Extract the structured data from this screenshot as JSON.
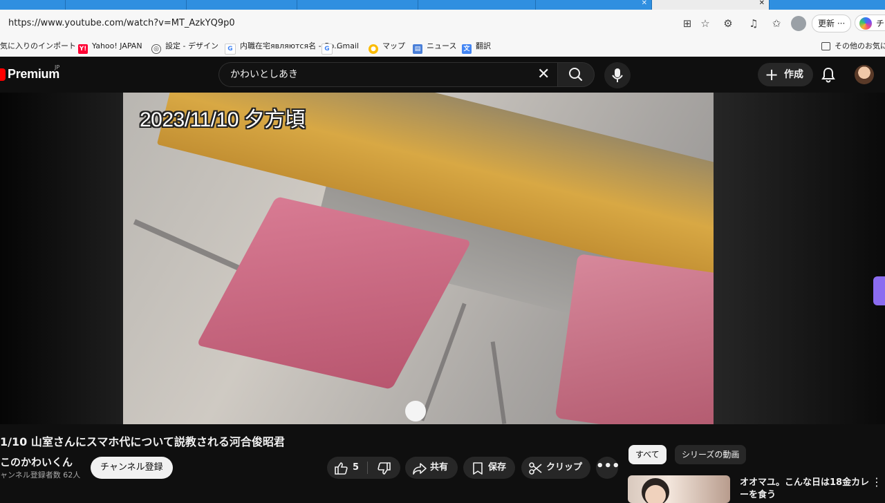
{
  "browser": {
    "tabs": [
      {
        "label": ""
      },
      {
        "label": ""
      },
      {
        "label": ""
      },
      {
        "label": ""
      },
      {
        "label": ""
      },
      {
        "label": ""
      },
      {
        "label": ""
      }
    ],
    "url": "https://www.youtube.com/watch?v=MT_AzkYQ9p0",
    "update_label": "更新",
    "copilot_label": "チャ",
    "bookmarks": [
      {
        "label": "気に入りのインポート"
      },
      {
        "label": "Yahoo! JAPAN"
      },
      {
        "label": "設定 - デザイン"
      },
      {
        "label": "内職在宅являются名 - Go..."
      },
      {
        "label": "Gmail"
      },
      {
        "label": "マップ"
      },
      {
        "label": "ニュース"
      },
      {
        "label": "翻訳"
      }
    ],
    "other_bookmarks": "その他のお気に入"
  },
  "masthead": {
    "logo_text": "Premium",
    "logo_region": "JP",
    "search_value": "かわいとしあき",
    "create_label": "作成"
  },
  "video": {
    "caption": "2023/11/10 夕方頃"
  },
  "watch": {
    "title": "1/10 山室さんにスマホ代について説教される河合俊昭君",
    "channel_name": "このかわいくん",
    "subscriber_count": "ャンネル登録者数 62人",
    "subscribe_label": "チャンネル登録",
    "like_count": "5",
    "share_label": "共有",
    "save_label": "保存",
    "clip_label": "クリップ"
  },
  "sidebar": {
    "chips": [
      {
        "label": "すべて"
      },
      {
        "label": "シリーズの動画"
      }
    ],
    "recommendation_title": "オオマユ。こんな日は18金カレーを食う"
  },
  "colors": {
    "page_bg": "#0f0f0f",
    "brand_red": "#ff0000",
    "browser_tab_blue": "#2f8fe0",
    "seat_pink": "#c8657e",
    "desk_orange": "#d8a844"
  }
}
